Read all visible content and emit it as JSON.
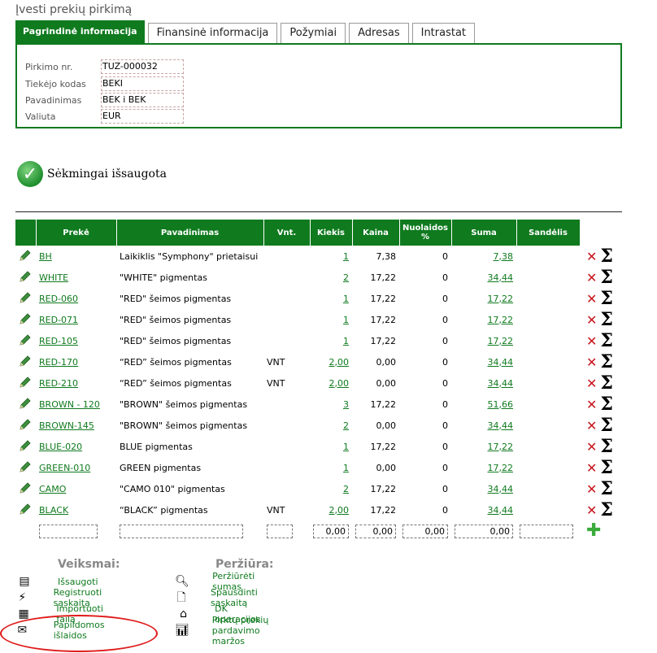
{
  "page": {
    "title": "Įvesti prekių pirkimą"
  },
  "tabs": [
    {
      "label": "Pagrindinė informacija"
    },
    {
      "label": "Finansinė informacija"
    },
    {
      "label": "Požymiai"
    },
    {
      "label": "Adresas"
    },
    {
      "label": "Intrastat"
    }
  ],
  "info": {
    "fields": [
      {
        "label": "Pirkimo nr.",
        "value": "TUZ-000032"
      },
      {
        "label": "Tiekėjo kodas",
        "value": "BEKI"
      },
      {
        "label": "Pavadinimas",
        "value": "BEK i BEK"
      },
      {
        "label": "Valiuta",
        "value": "EUR"
      }
    ]
  },
  "status": {
    "text": "Sėkmingai išsaugota"
  },
  "table": {
    "headers": [
      "Prekė",
      "Pavadinimas",
      "Vnt.",
      "Kiekis",
      "Kaina",
      "Nuolaidos %",
      "Suma",
      "Sandėlis"
    ],
    "rows": [
      {
        "code": "BH",
        "name": "Laikiklis \"Symphony\" prietaisui",
        "unit": "",
        "qty": "1",
        "price": "7,38",
        "disc": "0",
        "sum": "7,38",
        "wh": ""
      },
      {
        "code": "WHITE",
        "name": "\"WHITE\" pigmentas",
        "unit": "",
        "qty": "2",
        "price": "17,22",
        "disc": "0",
        "sum": "34,44",
        "wh": ""
      },
      {
        "code": "RED-060",
        "name": "\"RED\" šeimos pigmentas",
        "unit": "",
        "qty": "1",
        "price": "17,22",
        "disc": "0",
        "sum": "17,22",
        "wh": ""
      },
      {
        "code": "RED-071",
        "name": "\"RED\" šeimos pigmentas",
        "unit": "",
        "qty": "1",
        "price": "17,22",
        "disc": "0",
        "sum": "17,22",
        "wh": ""
      },
      {
        "code": "RED-105",
        "name": "\"RED\" šeimos pigmentas",
        "unit": "",
        "qty": "1",
        "price": "17,22",
        "disc": "0",
        "sum": "17,22",
        "wh": ""
      },
      {
        "code": "RED-170",
        "name": "“RED” šeimos pigmentas",
        "unit": "VNT",
        "qty": "2,00",
        "price": "0,00",
        "disc": "0",
        "sum": "34,44",
        "wh": ""
      },
      {
        "code": "RED-210",
        "name": "“RED” šeimos pigmentas",
        "unit": "VNT",
        "qty": "2,00",
        "price": "0,00",
        "disc": "0",
        "sum": "34,44",
        "wh": ""
      },
      {
        "code": "BROWN - 120",
        "name": "\"BROWN\" šeimos pigmentas",
        "unit": "",
        "qty": "3",
        "price": "17,22",
        "disc": "0",
        "sum": "51,66",
        "wh": ""
      },
      {
        "code": "BROWN-145",
        "name": "\"BROWN\" šeimos pigmentas",
        "unit": "",
        "qty": "2",
        "price": "0,00",
        "disc": "0",
        "sum": "34,44",
        "wh": ""
      },
      {
        "code": "BLUE-020",
        "name": "BLUE pigmentas",
        "unit": "",
        "qty": "1",
        "price": "17,22",
        "disc": "0",
        "sum": "17,22",
        "wh": ""
      },
      {
        "code": "GREEN-010",
        "name": "GREEN pigmentas",
        "unit": "",
        "qty": "1",
        "price": "0,00",
        "disc": "0",
        "sum": "17,22",
        "wh": ""
      },
      {
        "code": "CAMO",
        "name": "\"CAMO 010\" pigmentas",
        "unit": "",
        "qty": "2",
        "price": "17,22",
        "disc": "0",
        "sum": "34,44",
        "wh": ""
      },
      {
        "code": "BLACK",
        "name": "“BLACK” pigmentas",
        "unit": "VNT",
        "qty": "2,00",
        "price": "17,22",
        "disc": "0",
        "sum": "34,44",
        "wh": ""
      }
    ],
    "new_row": {
      "code": "",
      "name": "",
      "unit": "",
      "qty": "0,00",
      "price": "0,00",
      "disc": "0,00",
      "sum": "0,00",
      "wh": ""
    }
  },
  "actions": {
    "title": "Veiksmai:",
    "items": [
      {
        "label": "Išsaugoti",
        "icon": "save-icon"
      },
      {
        "label": "Registruoti sąskaitą",
        "icon": "lightning-icon"
      },
      {
        "label": "Importuoti failą",
        "icon": "grid-icon"
      },
      {
        "label": "Papildomos išlaidos",
        "icon": "envelope-icon"
      }
    ]
  },
  "view": {
    "title": "Peržiūra:",
    "items": [
      {
        "label": "Peržiūrėti sumas",
        "icon": "magnifier-icon"
      },
      {
        "label": "Spausdinti sąskaitą",
        "icon": "document-icon"
      },
      {
        "label": "DK operacijos",
        "icon": "home-icon"
      },
      {
        "label": "Pirktų prekių pardavimo maržos",
        "icon": "bar-chart-icon"
      }
    ]
  },
  "colors": {
    "brand": "#0f7a1e",
    "delete": "#c8161d",
    "annotation": "#e01b1b"
  }
}
